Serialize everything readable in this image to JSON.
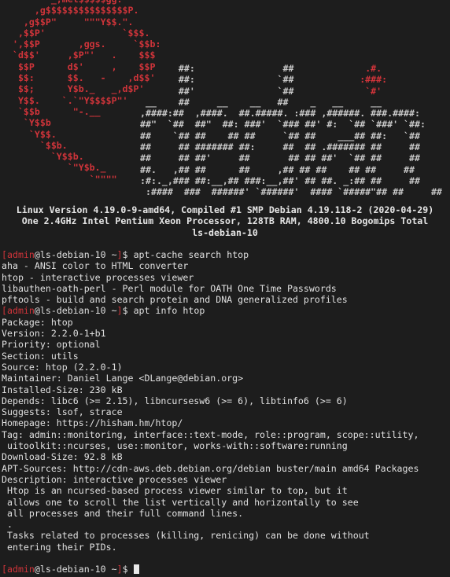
{
  "colors": {
    "background": "#1d1d1d",
    "text": "#e0e0e0",
    "accent_red": "#d0343a"
  },
  "banner": {
    "logo_text": "debian",
    "version_line": "Linux Version 4.19.0-9-amd64, Compiled #1 SMP Debian 4.19.118-2 (2020-04-29)",
    "hardware_line": "One 2.4GHz Intel Pentium Xeon Processor, 128TB RAM, 4800.10 Bogomips Total",
    "hostname_line": "ls-debian-10"
  },
  "prompt": {
    "user": "admin",
    "host": "ls-debian-10",
    "path": "~",
    "symbol": "$"
  },
  "session": {
    "command1": "apt-cache search htop",
    "search_results": [
      "aha - ANSI color to HTML converter",
      "htop - interactive processes viewer",
      "libauthen-oath-perl - Perl module for OATH One Time Passwords",
      "pftools - build and search protein and DNA generalized profiles"
    ],
    "command2": "apt info htop",
    "info_lines": [
      "Package: htop",
      "Version: 2.2.0-1+b1",
      "Priority: optional",
      "Section: utils",
      "Source: htop (2.2.0-1)",
      "Maintainer: Daniel Lange <DLange@debian.org>",
      "Installed-Size: 230 kB",
      "Depends: libc6 (>= 2.15), libncursesw6 (>= 6), libtinfo6 (>= 6)",
      "Suggests: lsof, strace",
      "Homepage: https://hisham.hm/htop/",
      "Tag: admin::monitoring, interface::text-mode, role::program, scope::utility,",
      " uitoolkit::ncurses, use::monitor, works-with::software:running",
      "Download-Size: 92.8 kB",
      "APT-Sources: http://cdn-aws.deb.debian.org/debian buster/main amd64 Packages",
      "Description: interactive processes viewer",
      " Htop is an ncursed-based process viewer similar to top, but it",
      " allows one to scroll the list vertically and horizontally to see",
      " all processes and their full command lines.",
      " .",
      " Tasks related to processes (killing, renicing) can be done without",
      " entering their PIDs."
    ],
    "command3": ""
  }
}
